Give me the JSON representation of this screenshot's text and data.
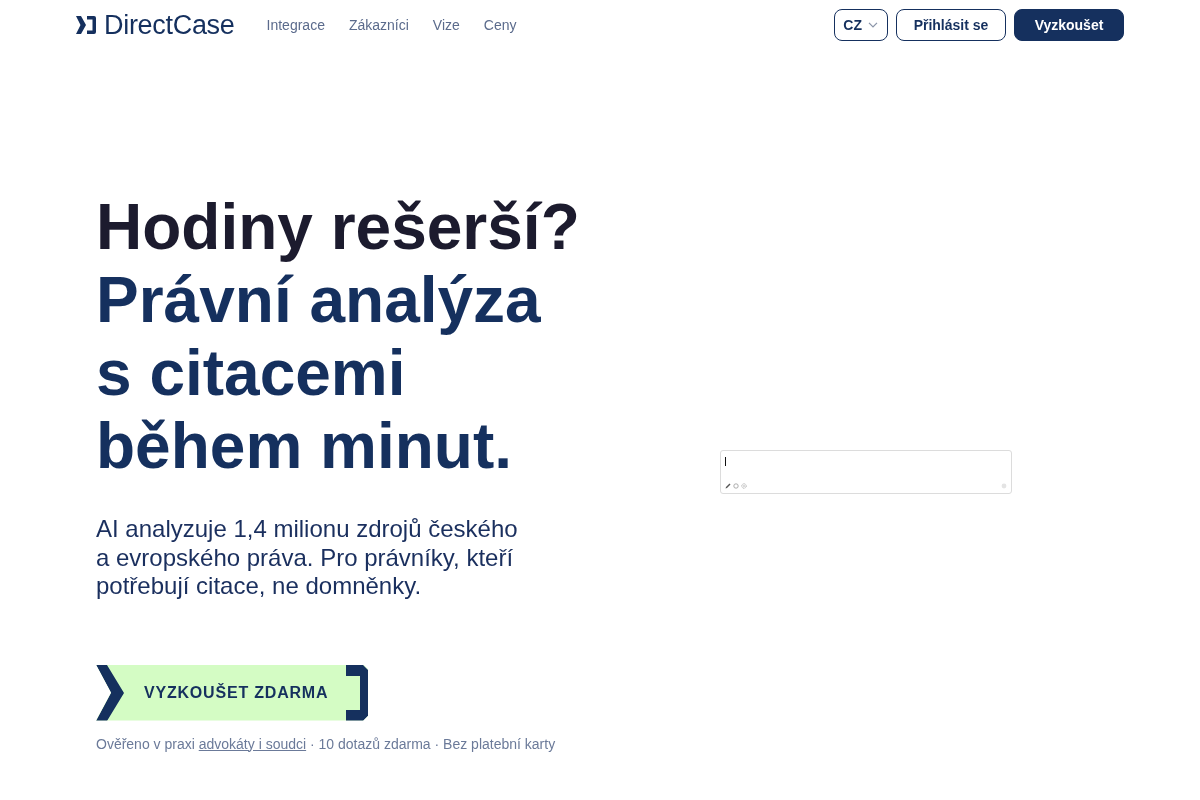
{
  "header": {
    "logo": {
      "text": "DirectCase"
    },
    "nav": [
      {
        "label": "Integrace"
      },
      {
        "label": "Zákazníci"
      },
      {
        "label": "Vize"
      },
      {
        "label": "Ceny"
      }
    ],
    "language": {
      "value": "CZ"
    },
    "buttons": [
      {
        "label": "Přihlásit se",
        "kind": "outline"
      },
      {
        "label": "Vyzkoušet",
        "kind": "primary"
      }
    ]
  },
  "hero": {
    "headline": {
      "question": "Hodiny rešerší?",
      "answer": "Právní analýza s citacemi během minut."
    },
    "subtitle": "AI analyzuje 1,4 milionu zdrojů českého a evropského práva. Pro právníky, kteří potřebují citace, ne domněnky.",
    "cta": {
      "label": "VYZKOUŠET ZDARMA"
    },
    "note": {
      "lead": "Ověřeno v praxi",
      "link": "advokáty i soudci",
      "rest": "· 10 dotazů zdarma · Bez platební karty"
    }
  },
  "prompt_box": {
    "focused": true
  }
}
